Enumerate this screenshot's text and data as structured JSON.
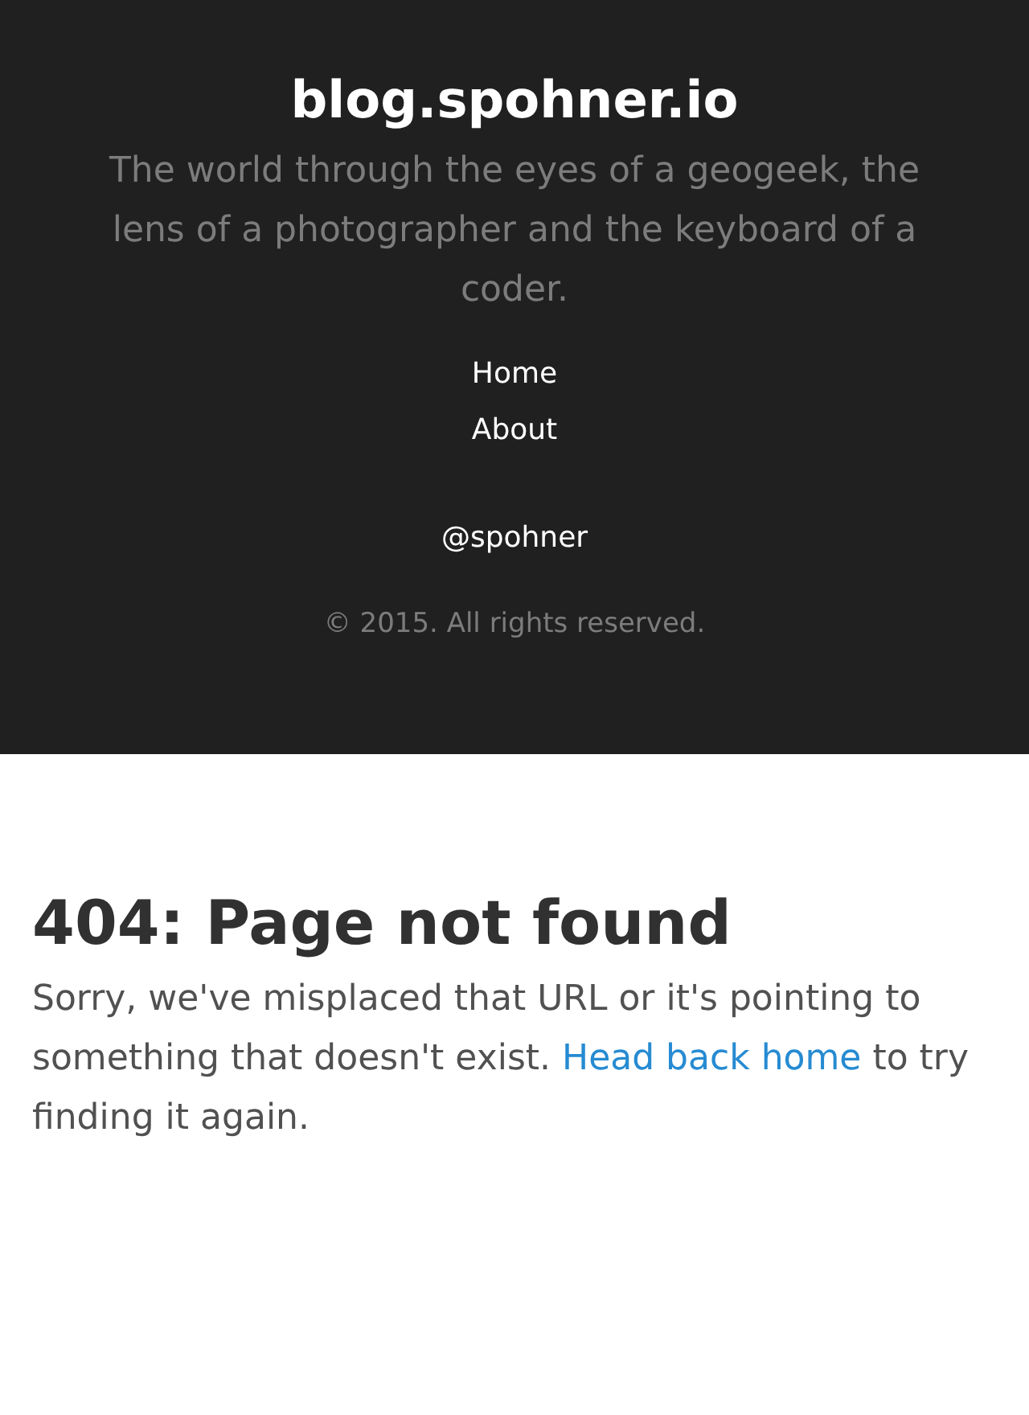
{
  "sidebar": {
    "title": "blog.spohner.io",
    "tagline": "The world through the eyes of a geogeek, the lens of a photographer and the keyboard of a coder.",
    "nav": [
      {
        "label": "Home"
      },
      {
        "label": "About"
      }
    ],
    "social": "@spohner",
    "copyright": "© 2015. All rights reserved."
  },
  "content": {
    "heading": "404: Page not found",
    "message": {
      "before": "Sorry, we've misplaced that URL or it's pointing to something that doesn't exist.",
      "link": "Head back home",
      "after": "to try finding it again."
    }
  }
}
